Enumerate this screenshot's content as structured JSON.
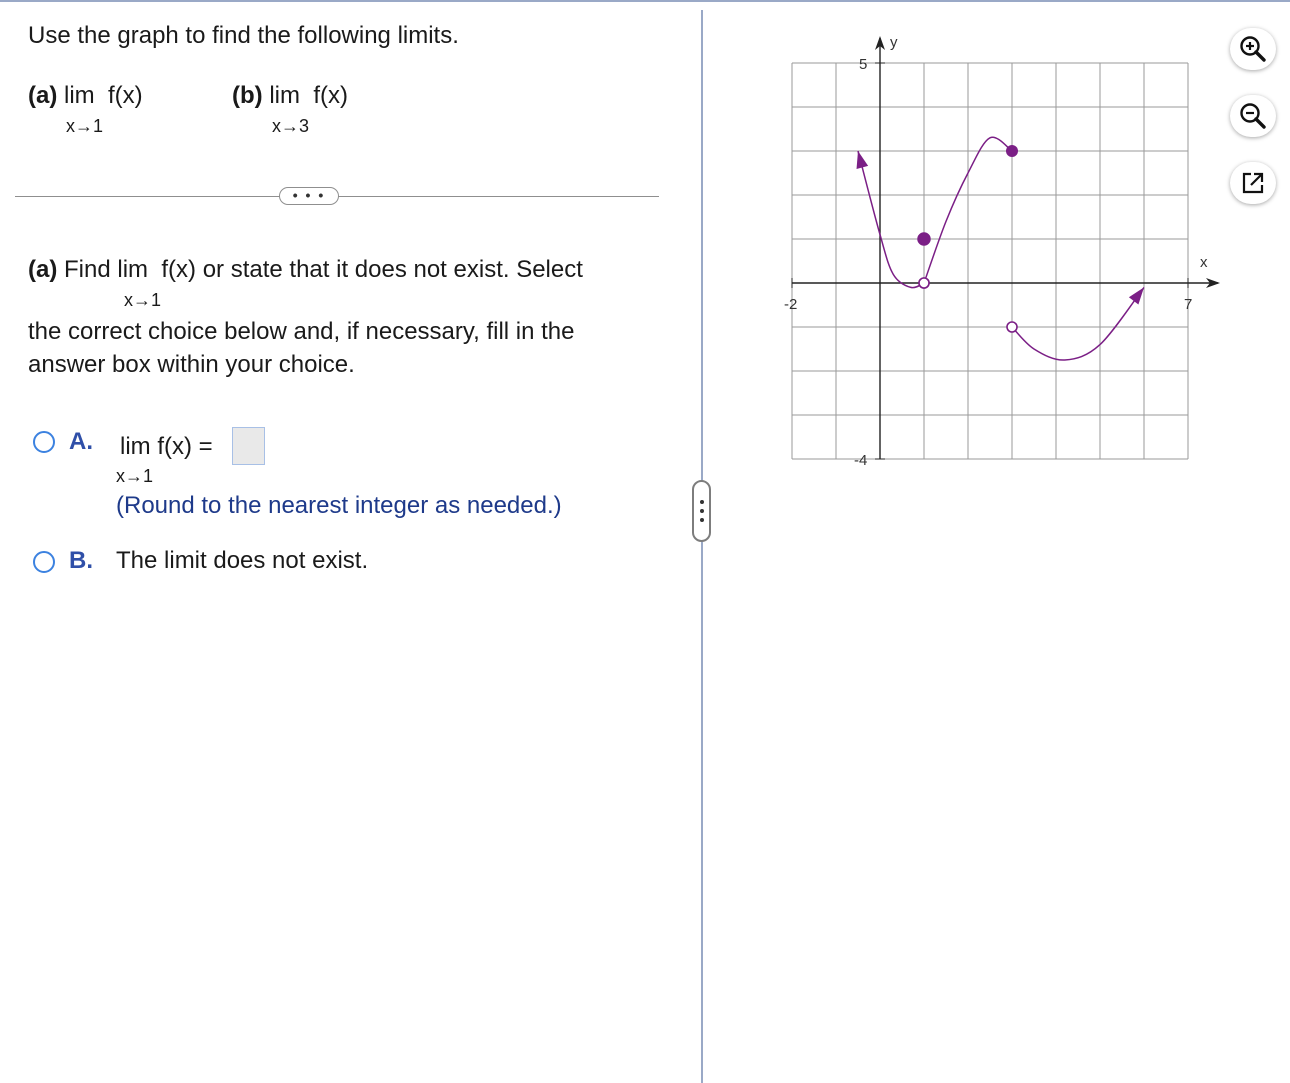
{
  "prompt": "Use the graph to find the following limits.",
  "limits": [
    {
      "label": "(a)",
      "expr": "lim  f(x)",
      "sub": "x→1"
    },
    {
      "label": "(b)",
      "expr": "lim  f(x)",
      "sub": "x→3"
    }
  ],
  "more_button": "• • •",
  "question": {
    "label": "(a)",
    "lead": "Find",
    "expr": "lim  f(x)",
    "after": "or state that it does not exist. Select",
    "sub": "x→1",
    "rest": "the correct choice below and, if necessary, fill in the answer box within your choice."
  },
  "choices": {
    "a": {
      "letter": "A.",
      "expr": "lim  f(x) =",
      "sub": "x→1",
      "answer": "",
      "hint": "(Round to the nearest integer as needed.)"
    },
    "b": {
      "letter": "B.",
      "text": "The limit does not exist."
    }
  },
  "graph": {
    "x_axis_label": "x",
    "y_axis_label": "y",
    "tick_labels": {
      "x_min": "-2",
      "x_max": "7",
      "y_max": "5",
      "y_min": "-4"
    },
    "curve_color": "#7b1f86",
    "grid_color": "#9a9a9a"
  },
  "chart_data": {
    "type": "line",
    "xlim": [
      -2,
      7
    ],
    "ylim": [
      -4,
      5
    ],
    "grid": true,
    "xlabel": "x",
    "ylabel": "y",
    "pieces": [
      {
        "points": [
          [
            -0.5,
            3
          ],
          [
            0,
            1.1
          ],
          [
            0.3,
            0.2
          ],
          [
            0.7,
            -0.1
          ],
          [
            1,
            0
          ]
        ],
        "left": "arrow",
        "right": "open"
      },
      {
        "points": [
          [
            1,
            0
          ],
          [
            1.5,
            1.4
          ],
          [
            2,
            2.5
          ],
          [
            2.5,
            3.3
          ],
          [
            3,
            3
          ]
        ],
        "left": "open",
        "right": "closed"
      },
      {
        "points": [
          [
            3,
            -1
          ],
          [
            3.5,
            -1.5
          ],
          [
            4.2,
            -1.75
          ],
          [
            5,
            -1.4
          ],
          [
            6,
            -0.1
          ]
        ],
        "left": "open",
        "right": "arrow"
      }
    ],
    "isolated_points": [
      {
        "x": 1,
        "y": 1,
        "filled": true
      }
    ]
  },
  "tools": [
    {
      "name": "zoom-in"
    },
    {
      "name": "zoom-out"
    },
    {
      "name": "open-new-window"
    }
  ]
}
